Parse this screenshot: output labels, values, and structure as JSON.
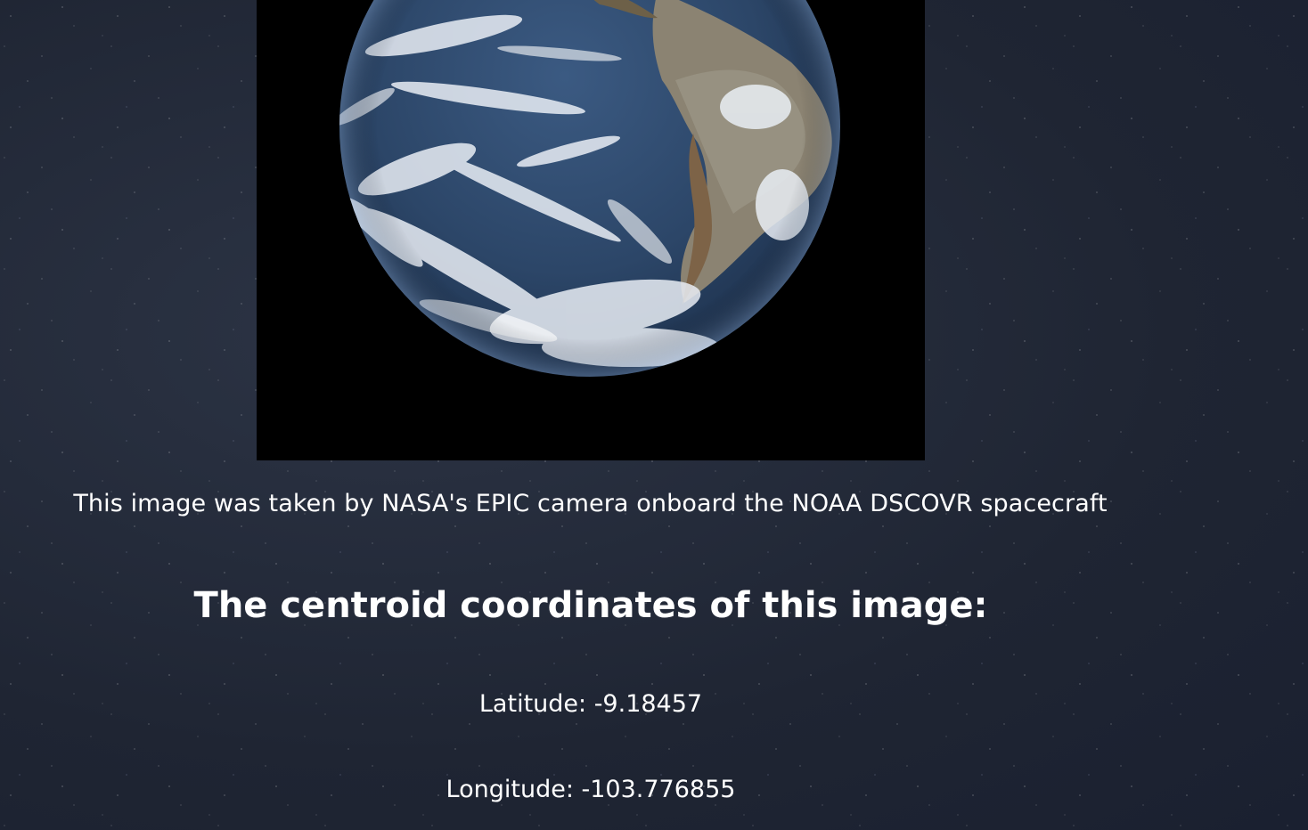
{
  "image": {
    "subject": "earth-globe-image",
    "background_color": "#000000"
  },
  "caption": "This image was taken by NASA's EPIC camera onboard the NOAA DSCOVR spacecraft",
  "coordinates": {
    "heading": "The centroid coordinates of this image:",
    "latitude_text": "Latitude: -9.18457",
    "longitude_text": "Longitude: -103.776855"
  },
  "colors": {
    "page_background": "#232a38",
    "text": "#ffffff",
    "ocean": "#2e4a6e",
    "land": "#7a6a52"
  }
}
